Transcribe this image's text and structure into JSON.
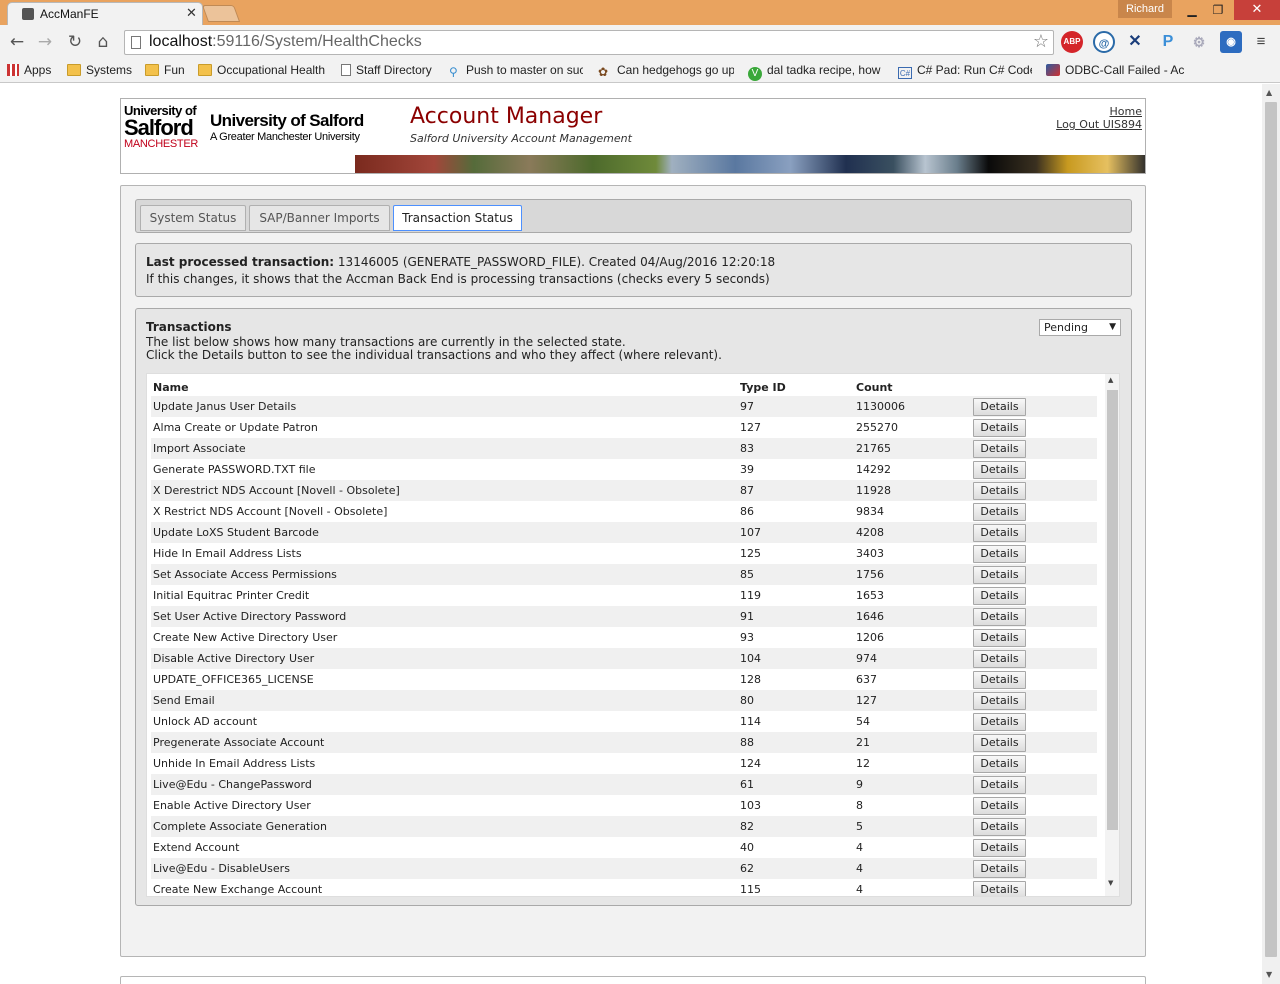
{
  "browser": {
    "tab_title": "AccManFE",
    "user_name": "Richard",
    "url_host": "localhost",
    "url_path": ":59116/System/HealthChecks",
    "bookmarks": [
      {
        "label": "Apps",
        "icon": "apps-grid-icon"
      },
      {
        "label": "Systems",
        "icon": "folder-icon"
      },
      {
        "label": "Fun",
        "icon": "folder-icon"
      },
      {
        "label": "Occupational Health",
        "icon": "folder-icon"
      },
      {
        "label": "Staff Directory",
        "icon": "page-icon"
      },
      {
        "label": "Push to master on suc",
        "icon": "push-icon"
      },
      {
        "label": "Can hedgehogs go up",
        "icon": "hedgehog-icon"
      },
      {
        "label": "dal tadka recipe, how",
        "icon": "v-icon"
      },
      {
        "label": "C# Pad: Run C# Code",
        "icon": "csharp-icon"
      },
      {
        "label": "ODBC-Call Failed - Ac",
        "icon": "odbc-icon"
      }
    ],
    "extensions": [
      "abp-icon",
      "swirl-icon",
      "tools-icon",
      "p-icon",
      "puzzle-icon",
      "bubble-icon",
      "menu-icon"
    ]
  },
  "header": {
    "logo_line1": "University of",
    "logo_line2": "Salford",
    "logo_line3": "MANCHESTER",
    "logo_name": "University of Salford",
    "logo_tagline": "A Greater Manchester University",
    "title": "Account Manager",
    "subtitle": "Salford University Account Management",
    "home_link": "Home",
    "logout_link": "Log Out UIS894"
  },
  "tabs": [
    {
      "label": "System Status",
      "active": false
    },
    {
      "label": "SAP/Banner Imports",
      "active": false
    },
    {
      "label": "Transaction Status",
      "active": true
    }
  ],
  "last_processed": {
    "label": "Last processed transaction:",
    "value": "13146005 (GENERATE_PASSWORD_FILE). Created 04/Aug/2016 12:20:18",
    "note": "If this changes, it shows that the Accman Back End is processing transactions (checks every 5 seconds)"
  },
  "transactions": {
    "heading": "Transactions",
    "desc1": "The list below shows how many transactions are currently in the selected state.",
    "desc2": "Click the Details button to see the individual transactions and who they affect (where relevant).",
    "state_selected": "Pending",
    "columns": {
      "name": "Name",
      "type_id": "Type ID",
      "count": "Count"
    },
    "details_label": "Details",
    "rows": [
      {
        "name": "Update Janus User Details",
        "type_id": "97",
        "count": "1130006"
      },
      {
        "name": "Alma Create or Update Patron",
        "type_id": "127",
        "count": "255270"
      },
      {
        "name": "Import Associate",
        "type_id": "83",
        "count": "21765"
      },
      {
        "name": "Generate PASSWORD.TXT file",
        "type_id": "39",
        "count": "14292"
      },
      {
        "name": "X Derestrict NDS Account [Novell - Obsolete]",
        "type_id": "87",
        "count": "11928"
      },
      {
        "name": "X Restrict NDS Account [Novell - Obsolete]",
        "type_id": "86",
        "count": "9834"
      },
      {
        "name": "Update LoXS Student Barcode",
        "type_id": "107",
        "count": "4208"
      },
      {
        "name": "Hide In Email Address Lists",
        "type_id": "125",
        "count": "3403"
      },
      {
        "name": "Set Associate Access Permissions",
        "type_id": "85",
        "count": "1756"
      },
      {
        "name": "Initial Equitrac Printer Credit",
        "type_id": "119",
        "count": "1653"
      },
      {
        "name": "Set User Active Directory Password",
        "type_id": "91",
        "count": "1646"
      },
      {
        "name": "Create New Active Directory User",
        "type_id": "93",
        "count": "1206"
      },
      {
        "name": "Disable Active Directory User",
        "type_id": "104",
        "count": "974"
      },
      {
        "name": "UPDATE_OFFICE365_LICENSE",
        "type_id": "128",
        "count": "637"
      },
      {
        "name": "Send Email",
        "type_id": "80",
        "count": "127"
      },
      {
        "name": "Unlock AD account",
        "type_id": "114",
        "count": "54"
      },
      {
        "name": "Pregenerate Associate Account",
        "type_id": "88",
        "count": "21"
      },
      {
        "name": "Unhide In Email Address Lists",
        "type_id": "124",
        "count": "12"
      },
      {
        "name": "Live@Edu - ChangePassword",
        "type_id": "61",
        "count": "9"
      },
      {
        "name": "Enable Active Directory User",
        "type_id": "103",
        "count": "8"
      },
      {
        "name": "Complete Associate Generation",
        "type_id": "82",
        "count": "5"
      },
      {
        "name": "Extend Account",
        "type_id": "40",
        "count": "4"
      },
      {
        "name": "Live@Edu - DisableUsers",
        "type_id": "62",
        "count": "4"
      },
      {
        "name": "Create New Exchange Account",
        "type_id": "115",
        "count": "4"
      }
    ]
  }
}
